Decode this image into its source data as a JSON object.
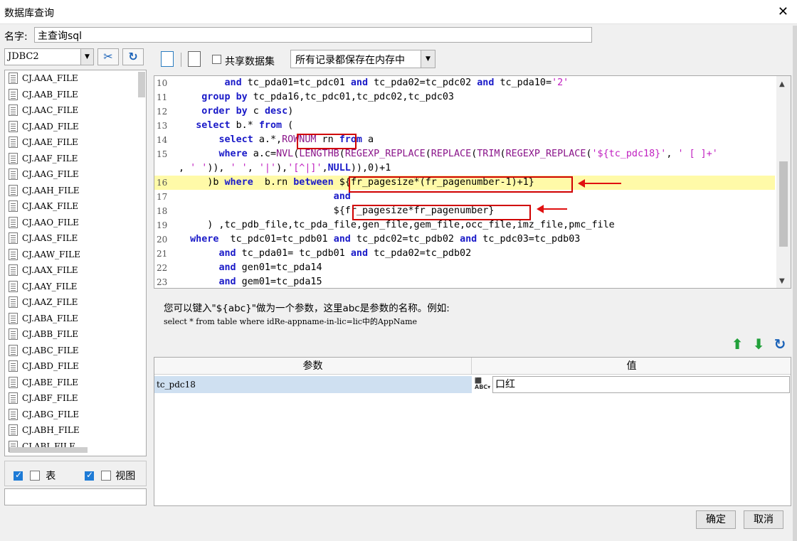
{
  "window": {
    "title": "数据库查询",
    "close_symbol": "✕"
  },
  "name_row": {
    "label": "名字:",
    "value": "主查询sql"
  },
  "left_panel": {
    "connection": "JDBC2",
    "items": [
      "CJ.AAA_FILE",
      "CJ.AAB_FILE",
      "CJ.AAC_FILE",
      "CJ.AAD_FILE",
      "CJ.AAE_FILE",
      "CJ.AAF_FILE",
      "CJ.AAG_FILE",
      "CJ.AAH_FILE",
      "CJ.AAK_FILE",
      "CJ.AAO_FILE",
      "CJ.AAS_FILE",
      "CJ.AAW_FILE",
      "CJ.AAX_FILE",
      "CJ.AAY_FILE",
      "CJ.AAZ_FILE",
      "CJ.ABA_FILE",
      "CJ.ABB_FILE",
      "CJ.ABC_FILE",
      "CJ.ABD_FILE",
      "CJ.ABE_FILE",
      "CJ.ABF_FILE",
      "CJ.ABG_FILE",
      "CJ.ABH_FILE",
      "CJ.ABI_FILE"
    ],
    "table_label": "表",
    "view_label": "视图",
    "table_checked": true,
    "view_checked": true
  },
  "editor_toolbar": {
    "share_label": "共享数据集",
    "share_checked": false,
    "memory_option": "所有记录都保存在内存中"
  },
  "code_lines": [
    {
      "num": "10",
      "text": "        and tc_pda01=tc_pdc01 and tc_pda02=tc_pdc02 and tc_pda10='2'"
    },
    {
      "num": "11",
      "text": "    group by tc_pda16,tc_pdc01,tc_pdc02,tc_pdc03"
    },
    {
      "num": "12",
      "text": "    order by c desc)"
    },
    {
      "num": "13",
      "text": "   select b.* from ("
    },
    {
      "num": "14",
      "text": "       select a.*,ROWNUM rn from a"
    },
    {
      "num": "15",
      "text": "       where a.c=NVL(LENGTHB(REGEXP_REPLACE(REPLACE(TRIM(REGEXP_REPLACE('${tc_pdc18}', ' [ ]+'"
    },
    {
      "num": "",
      "text": ", ' ')), ' ', '|'),'[^|]',NULL)),0)+1"
    },
    {
      "num": "16",
      "text": "     )b where  b.rn between ${fr_pagesize*(fr_pagenumber-1)+1}"
    },
    {
      "num": "17",
      "text": "                           and"
    },
    {
      "num": "18",
      "text": "                           ${fr_pagesize*fr_pagenumber}"
    },
    {
      "num": "19",
      "text": "     ) ,tc_pdb_file,tc_pda_file,gen_file,gem_file,occ_file,imz_file,pmc_file"
    },
    {
      "num": "20",
      "text": "  where  tc_pdc01=tc_pdb01 and tc_pdc02=tc_pdb02 and tc_pdc03=tc_pdb03"
    },
    {
      "num": "21",
      "text": "       and tc_pda01= tc_pdb01 and tc_pda02=tc_pdb02"
    },
    {
      "num": "22",
      "text": "       and gen01=tc_pda14"
    },
    {
      "num": "23",
      "text": "       and gem01=tc_pda15"
    }
  ],
  "hint": {
    "line1": "您可以键入\"${abc}\"做为一个参数，这里abc是参数的名称。例如:",
    "line2": "select * from table where idRe-appname-in-lic=lic中的AppName"
  },
  "params": {
    "header_param": "参数",
    "header_value": "值",
    "rows": [
      {
        "name": "tc_pdc18",
        "value": "口红"
      }
    ]
  },
  "footer": {
    "ok_label": "确定",
    "cancel_label": "取消"
  },
  "colors": {
    "keyword": "#1a1ac8",
    "string": "#c01fc0",
    "highlight": "#fffaa8",
    "annotation_red": "#d00000"
  }
}
